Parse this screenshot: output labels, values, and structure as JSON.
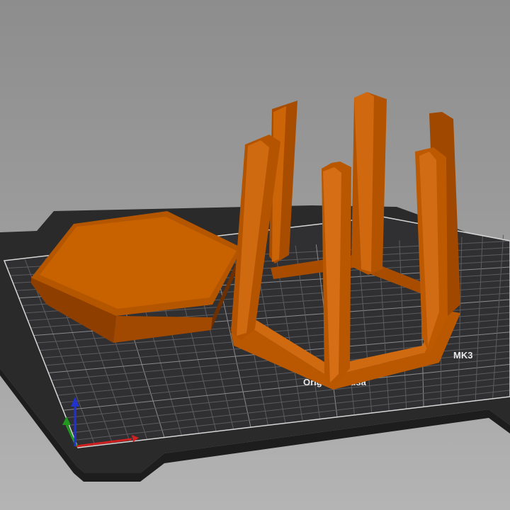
{
  "viewport": {
    "background_top": "#8d8d8d",
    "background_bottom": "#b4b4b4"
  },
  "bed": {
    "surface_color": "#2e2e30",
    "grid_color": "#6a6a6c",
    "border_color": "#d8d8d8",
    "label_model": "MK3",
    "label_brand": "Original Prusa"
  },
  "objects": [
    {
      "name": "hexagonal-base",
      "color": "#c65e00"
    },
    {
      "name": "hexagonal-frame",
      "color": "#c65e00"
    }
  ],
  "axes": {
    "x_color": "#d12020",
    "y_color": "#1f9a1f",
    "z_color": "#2233cc"
  }
}
